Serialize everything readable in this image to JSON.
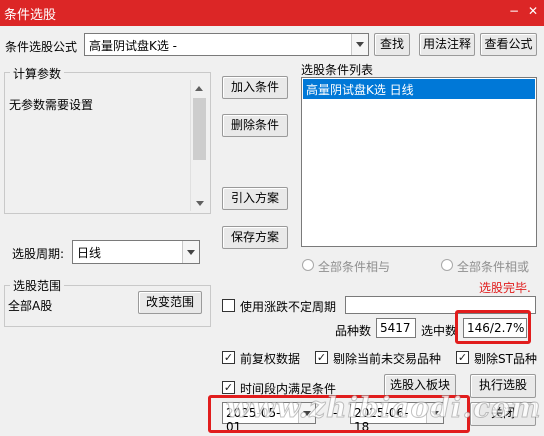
{
  "window": {
    "title": "条件选股",
    "minimize": "−",
    "close": "✕"
  },
  "formula": {
    "label": "条件选股公式",
    "value": "高量阴试盘K选  -"
  },
  "buttons": {
    "find": "查找",
    "usage_notes": "用法注释",
    "view_formula": "查看公式",
    "add_condition": "加入条件",
    "delete_condition": "删除条件",
    "import_plan": "引入方案",
    "save_plan": "保存方案",
    "change_scope": "改变范围",
    "select_into_block": "选股入板块",
    "execute": "执行选股",
    "close": "关闭"
  },
  "params": {
    "legend": "计算参数",
    "message": "无参数需要设置"
  },
  "conditions": {
    "legend": "选股条件列表",
    "items": [
      "高量阴试盘K选  日线"
    ]
  },
  "period": {
    "label": "选股周期:",
    "value": "日线"
  },
  "logic": {
    "all_and": "全部条件相与",
    "all_or": "全部条件相或"
  },
  "status": "选股完毕.",
  "scope": {
    "legend": "选股范围",
    "value": "全部A股"
  },
  "variable_period": {
    "label": "使用涨跌不定周期",
    "value": ""
  },
  "counts": {
    "total_label": "品种数",
    "total_value": "5417",
    "selected_label": "选中数",
    "selected_value": "146/2.7%"
  },
  "options": {
    "forward_adjust": "前复权数据",
    "exclude_untraded": "剔除当前未交易品种",
    "exclude_st": "剔除ST品种",
    "time_range": "时间段内满足条件"
  },
  "dates": {
    "start": "2025-05-01",
    "separator": "-",
    "end": "2025-06-18"
  },
  "watermark": "www.zhibiaodi.com",
  "colors": {
    "title_bar": "#dc2626",
    "highlight": "#e11d1d",
    "selection": "#0078d7"
  }
}
